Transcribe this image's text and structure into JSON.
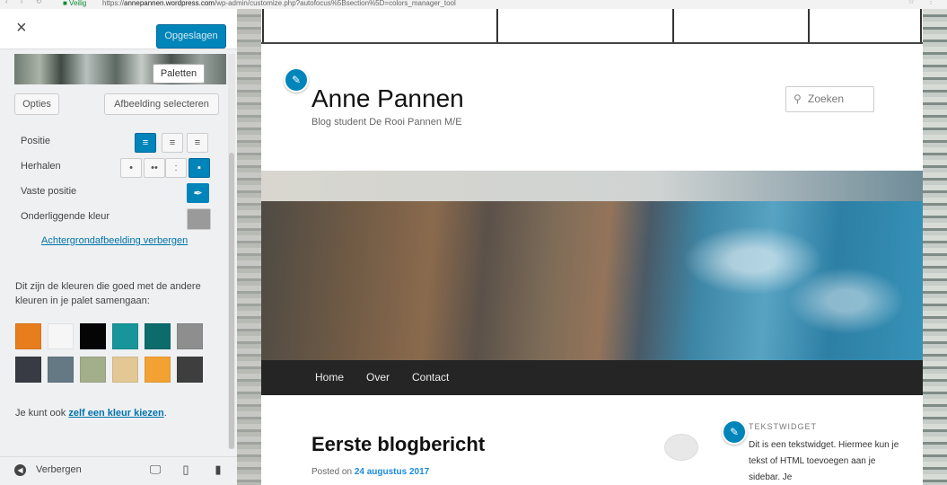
{
  "browser": {
    "nav_glyphs": "‹ › ↻",
    "secure_label": "■ Veilig",
    "url_prefix": "https://",
    "url_host": "annepannen.wordpress.com",
    "url_path": "/wp-admin/customize.php?autofocus%5Bsection%5D=colors_manager_tool",
    "right_glyphs": "☆ ⋮"
  },
  "sidebar": {
    "close_glyph": "×",
    "save_label": "Opgeslagen",
    "tooltip": "Paletten",
    "options_label": "Opties",
    "select_image_label": "Afbeelding selecteren",
    "position_label": "Positie",
    "repeat_label": "Herhalen",
    "fixed_label": "Vaste positie",
    "underlying_color_label": "Onderliggende kleur",
    "hide_bg_link": "Achtergrondafbeelding verbergen",
    "palette_desc": "Dit zijn de kleuren die goed met de andere kleuren in je palet samengaan:",
    "choose_prefix": "Je kunt ook ",
    "choose_link": "zelf een kleur kiezen",
    "choose_suffix": ".",
    "hide_label": "Verbergen",
    "underlying_color": "#9a9a9a",
    "swatches_row1": [
      "#e87d1e",
      "#f6f6f6",
      "#050505",
      "#17959a",
      "#0c6b6b",
      "#8e8e8e"
    ],
    "swatches_row2": [
      "#383a44",
      "#647984",
      "#a3ae8a",
      "#e3c794",
      "#f2a232",
      "#3e3e3e"
    ]
  },
  "preview": {
    "site_title": "Anne Pannen",
    "site_desc": "Blog student De Rooi Pannen M/E",
    "search_placeholder": "Zoeken",
    "nav": [
      "Home",
      "Over",
      "Contact"
    ],
    "post_title": "Eerste blogbericht",
    "posted_prefix": "Posted on ",
    "posted_date": "24 augustus 2017",
    "widget_title": "TEKSTWIDGET",
    "widget_text": "Dit is een tekstwidget. Hiermee kun je tekst of HTML toevoegen aan je sidebar. Je"
  }
}
